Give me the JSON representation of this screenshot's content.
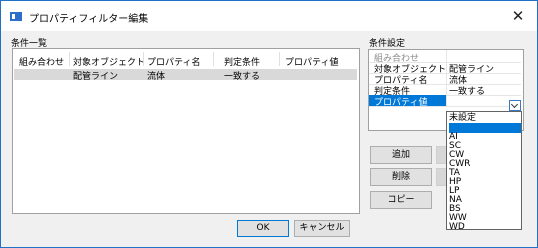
{
  "window": {
    "title": "プロパティフィルター編集",
    "close_glyph": "✕"
  },
  "list_group": {
    "label": "条件一覧",
    "columns": [
      "組み合わせ",
      "対象オブジェクト",
      "プロパティ名",
      "判定条件",
      "プロパティ値"
    ],
    "rows": [
      {
        "combine": "",
        "object": "配管ライン",
        "property": "流体",
        "condition": "一致する",
        "value": ""
      }
    ]
  },
  "settings_group": {
    "label": "条件設定",
    "rows": [
      {
        "key": "組み合わせ",
        "value": ""
      },
      {
        "key": "対象オブジェクト",
        "value": "配管ライン"
      },
      {
        "key": "プロパティ名",
        "value": "流体"
      },
      {
        "key": "判定条件",
        "value": "一致する"
      },
      {
        "key": "プロパティ値",
        "value": ""
      }
    ]
  },
  "buttons": {
    "add": "追加",
    "delete": "削除",
    "copy": "コピー",
    "ok": "OK",
    "cancel": "キャンセル"
  },
  "dropdown": {
    "options": [
      "未設定",
      "",
      "AI",
      "SC",
      "CW",
      "CWR",
      "TA",
      "HP",
      "LP",
      "NA",
      "BS",
      "WW",
      "WD"
    ],
    "selected_index": 1
  },
  "colors": {
    "selection": "#0078d7",
    "window_border": "#1f72c8"
  }
}
